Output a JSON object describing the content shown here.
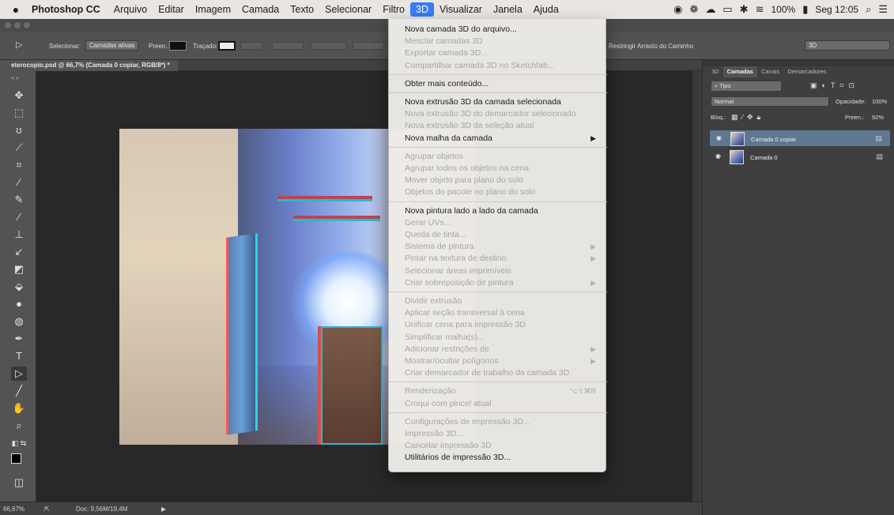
{
  "menubar": {
    "app_name": "Photoshop CC",
    "items": [
      "Arquivo",
      "Editar",
      "Imagem",
      "Camada",
      "Texto",
      "Selecionar",
      "Filtro",
      "3D",
      "Visualizar",
      "Janela",
      "Ajuda"
    ],
    "active": "3D",
    "battery": "100%",
    "clock": "Seg 12:05"
  },
  "options_bar": {
    "select_label": "Selecionar:",
    "select_value": "Camadas ativas",
    "fill_label": "Preen.:",
    "stroke_label": "Traçado:",
    "restrict_label": "Restringir Arrasto do Caminho",
    "workspace": "3D"
  },
  "document": {
    "tab_title": "eterocopio.psd @ 66,7% (Camada 0 copiar, RGB/8*) *"
  },
  "status": {
    "zoom": "66,67%",
    "doc": "Doc: 9,56M/19,4M"
  },
  "panel": {
    "tabs": [
      "3D",
      "Camadas",
      "Canais",
      "Demarcadores"
    ],
    "active_tab": "Camadas",
    "filter_kind": "Tipo",
    "blend_mode": "Normal",
    "opacity_label": "Opacidade:",
    "opacity": "100%",
    "lock_label": "Bloq.:",
    "fill_label": "Preen.:",
    "fill": "92%",
    "layers": [
      "Camada 0 copiar",
      "Camada 0"
    ],
    "selected_layer": "Camada 0 copiar"
  },
  "menu_3d": {
    "items": [
      {
        "label": "Nova camada 3D do arquivo...",
        "enabled": true
      },
      {
        "label": "Mesclar camadas 3D",
        "enabled": false
      },
      {
        "label": "Exportar camada 3D...",
        "enabled": false
      },
      {
        "label": "Compartilhar camada 3D no Sketchfab...",
        "enabled": false
      },
      {
        "label": "Obter mais conteúdo...",
        "enabled": true
      },
      {
        "label": "Nova extrusão 3D da camada selecionada",
        "enabled": true
      },
      {
        "label": "Nova extrusão 3D do demarcador selecionado",
        "enabled": false
      },
      {
        "label": "Nova extrusão 3D da seleção atual",
        "enabled": false
      },
      {
        "label": "Nova malha da camada",
        "enabled": true,
        "submenu": true
      },
      {
        "label": "Agrupar objetos",
        "enabled": false
      },
      {
        "label": "Agrupar todos os objetos na cena",
        "enabled": false
      },
      {
        "label": "Mover objeto para plano do solo",
        "enabled": false
      },
      {
        "label": "Objetos do pacote no plano do solo",
        "enabled": false
      },
      {
        "label": "Nova pintura lado a lado da camada",
        "enabled": true
      },
      {
        "label": "Gerar UVs...",
        "enabled": false
      },
      {
        "label": "Queda de tinta...",
        "enabled": false
      },
      {
        "label": "Sistema de pintura",
        "enabled": false,
        "submenu": true
      },
      {
        "label": "Pintar na textura de destino",
        "enabled": false,
        "submenu": true
      },
      {
        "label": "Selecionar áreas imprimíveis",
        "enabled": false
      },
      {
        "label": "Criar sobreposição de pintura",
        "enabled": false,
        "submenu": true
      },
      {
        "label": "Dividir extrusão",
        "enabled": false
      },
      {
        "label": "Aplicar seção transversal à cena",
        "enabled": false
      },
      {
        "label": "Unificar cena para impressão 3D",
        "enabled": false
      },
      {
        "label": "Simplificar malha(s)...",
        "enabled": false
      },
      {
        "label": "Adicionar restrições de",
        "enabled": false,
        "submenu": true
      },
      {
        "label": "Mostrar/ocultar polígonos",
        "enabled": false,
        "submenu": true
      },
      {
        "label": "Criar demarcador de trabalho da camada 3D",
        "enabled": false
      },
      {
        "label": "Renderização",
        "enabled": false,
        "shortcut": "⌥⇧⌘R"
      },
      {
        "label": "Croqui com pincel atual",
        "enabled": false
      },
      {
        "label": "Configurações de impressão 3D...",
        "enabled": false
      },
      {
        "label": "Impressão 3D...",
        "enabled": false
      },
      {
        "label": "Cancelar impressão 3D",
        "enabled": false
      },
      {
        "label": "Utilitários de impressão 3D...",
        "enabled": true
      }
    ]
  },
  "colors": {
    "menu_highlight": "#3a7cf0",
    "selected_layer": "#5f7891"
  }
}
